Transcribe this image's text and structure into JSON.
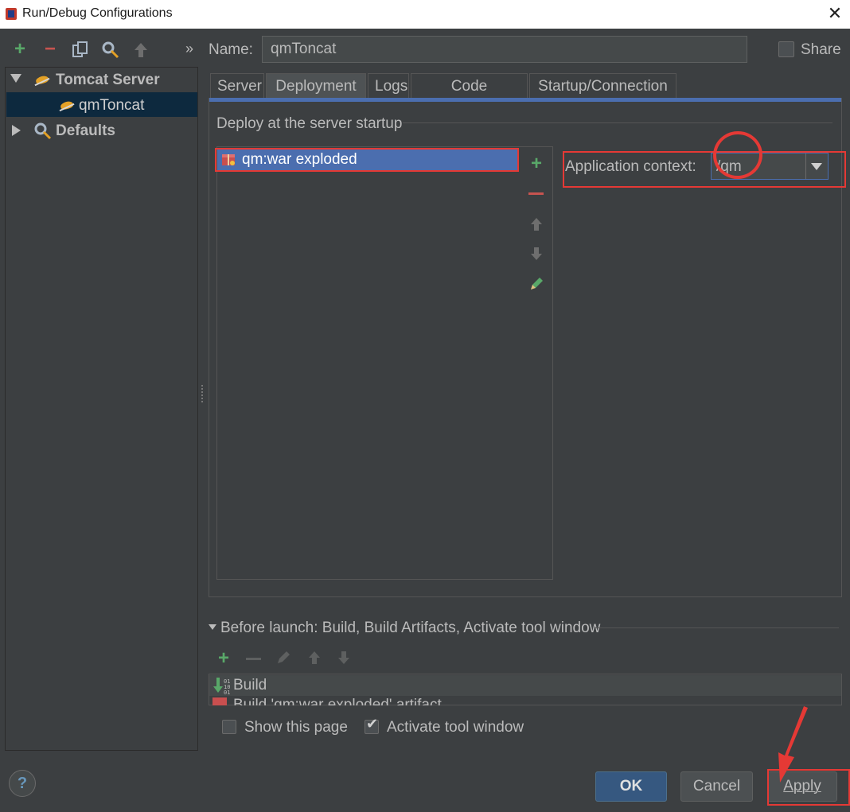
{
  "window": {
    "title": "Run/Debug Configurations",
    "close_symbol": "✕"
  },
  "toolbar": {
    "add_symbol": "+",
    "remove_symbol": "−",
    "more_symbol": "»",
    "colors": {
      "add": "#59a869",
      "remove": "#c75450"
    }
  },
  "tree": {
    "groups": [
      {
        "label": "Tomcat Server",
        "expanded": true,
        "icon": "tomcat-icon",
        "children": [
          {
            "label": "qmToncat",
            "selected": true,
            "icon": "tomcat-icon"
          }
        ]
      },
      {
        "label": "Defaults",
        "expanded": false,
        "icon": "wrench-icon",
        "children": []
      }
    ]
  },
  "name_field": {
    "label": "Name:",
    "value": "qmToncat"
  },
  "share": {
    "label": "Share",
    "checked": false
  },
  "tabs": [
    {
      "label": "Server",
      "active": false
    },
    {
      "label": "Deployment",
      "active": true
    },
    {
      "label": "Logs",
      "active": false
    },
    {
      "label": "Code Coverage",
      "active": false
    },
    {
      "label": "Startup/Connection",
      "active": false
    }
  ],
  "deployment": {
    "heading": "Deploy at the server startup",
    "artifacts": [
      {
        "label": "qm:war exploded",
        "selected": true,
        "icon": "artifact-icon"
      }
    ],
    "list_tools": [
      "add-icon",
      "remove-icon",
      "move-up-icon",
      "move-down-icon",
      "edit-icon"
    ],
    "app_context": {
      "label": "Application context:",
      "value": "/qm"
    }
  },
  "before_launch": {
    "label": "Before launch: Build, Build Artifacts, Activate tool window",
    "tools": [
      "add-icon",
      "remove-icon",
      "edit-icon",
      "move-up-icon",
      "move-down-icon"
    ],
    "items": [
      {
        "label": "Build",
        "icon": "build-icon"
      },
      {
        "label": "Build 'qm:war exploded' artifact",
        "icon": "artifact-icon"
      }
    ]
  },
  "options": {
    "show_page": {
      "label": "Show this page",
      "checked": false
    },
    "activate_tool": {
      "label": "Activate tool window",
      "checked": true
    }
  },
  "buttons": {
    "help": "?",
    "ok": "OK",
    "cancel": "Cancel",
    "apply": "Apply"
  },
  "annotation_colors": {
    "highlight": "#e53935",
    "selection": "#4b6eaf"
  }
}
